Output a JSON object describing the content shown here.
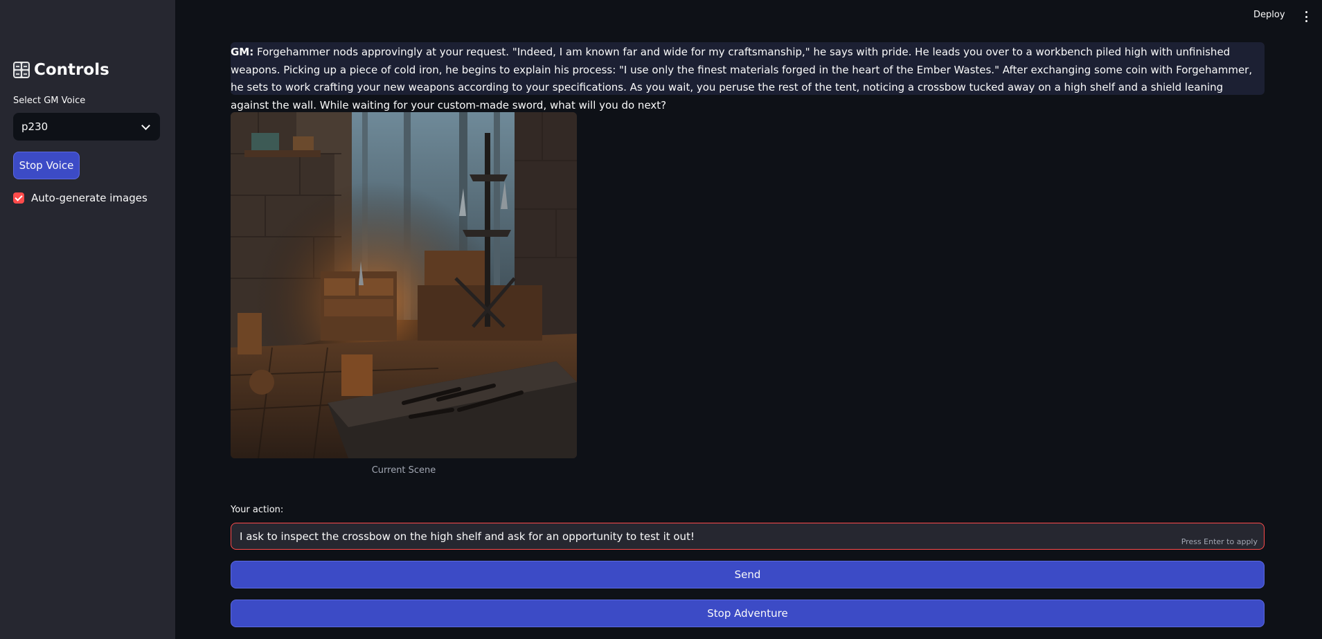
{
  "header": {
    "deploy_label": "Deploy",
    "menu_icon": "kebab-menu-icon"
  },
  "sidebar": {
    "title": "Controls",
    "title_icon": "control-knobs-icon",
    "voice_label": "Select GM Voice",
    "voice_value": "p230",
    "stop_voice_label": "Stop Voice",
    "auto_generate_label": "Auto-generate images",
    "auto_generate_checked": true
  },
  "main": {
    "gm_prefix": "GM:",
    "gm_text": " Forgehammer nods approvingly at your request. \"Indeed, I am known far and wide for my craftsmanship,\" he says with pride. He leads you over to a workbench piled high with unfinished weapons. Picking up a piece of cold iron, he begins to explain his process: \"I use only the finest materials forged in the heart of the Ember Wastes.\" After exchanging some coin with Forgehammer, he sets to work crafting your new weapons according to your specifications. As you wait, you peruse the rest of the tent, noticing a crossbow tucked away on a high shelf and a shield leaning against the wall. While waiting for your custom-made sword, what will you do next?",
    "scene_caption": "Current Scene",
    "action_label": "Your action:",
    "action_value": "I ask to inspect the crossbow on the high shelf and ask for an opportunity to test it out!",
    "action_hint": "Press Enter to apply",
    "send_label": "Send",
    "stop_adventure_label": "Stop Adventure"
  },
  "colors": {
    "background": "#0e1117",
    "sidebar": "#262730",
    "primary_button": "#3c4bc6",
    "accent_red": "#ff4b4b",
    "info_box": "#1c2033"
  }
}
